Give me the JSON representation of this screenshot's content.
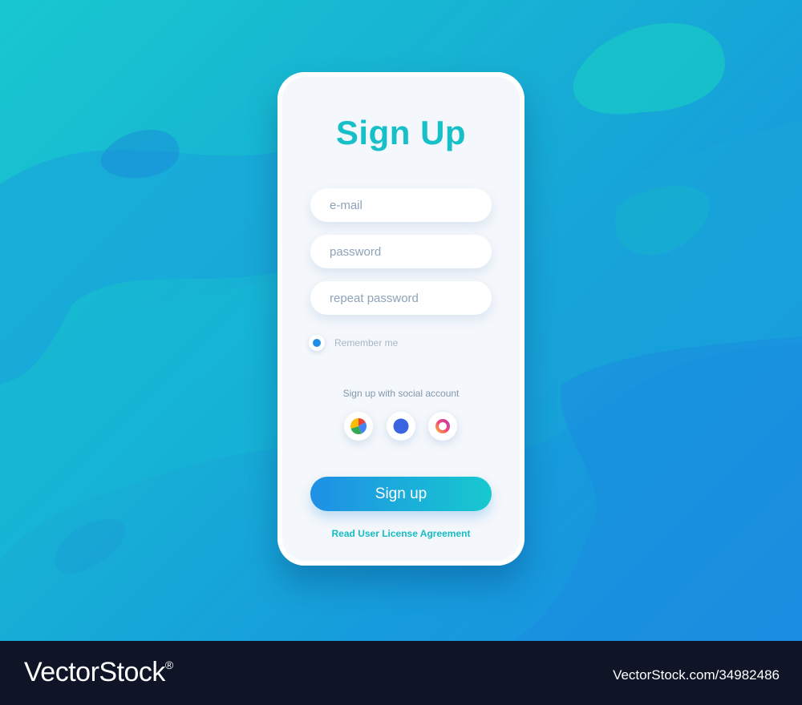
{
  "form": {
    "title": "Sign Up",
    "fields": [
      {
        "placeholder": "e-mail",
        "value": ""
      },
      {
        "placeholder": "password",
        "value": ""
      },
      {
        "placeholder": "repeat password",
        "value": ""
      }
    ],
    "remember_label": "Remember me",
    "remember_checked": true,
    "social_caption": "Sign up with social account",
    "social_icons": [
      "google-icon",
      "facebook-icon",
      "instagram-icon"
    ],
    "submit_label": "Sign up",
    "license_link": "Read User License Agreement"
  },
  "watermark": {
    "brand": "VectorStock",
    "registered_mark": "®",
    "stock_id": "VectorStock.com/34982486"
  },
  "colors": {
    "accent_teal": "#17c0c8",
    "button_gradient_start": "#1f8fe6",
    "button_gradient_end": "#17c9cf",
    "card_background": "#f4f7fb",
    "footer_background": "#0f1526"
  }
}
